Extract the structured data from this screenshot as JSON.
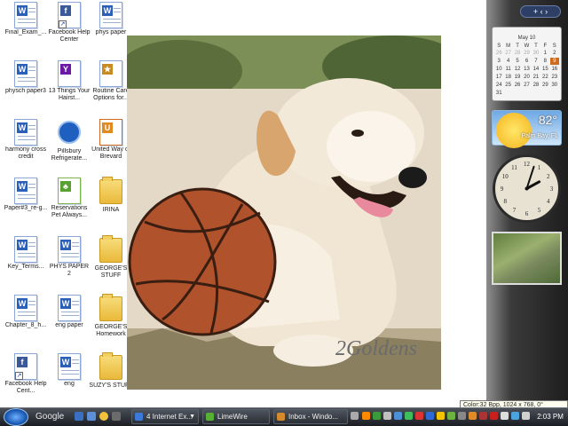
{
  "desktop_icons": [
    {
      "label": "Final_Exam_...",
      "type": "doc"
    },
    {
      "label": "Facebook Help Center",
      "type": "shortcut-page"
    },
    {
      "label": "phys paper",
      "type": "doc"
    },
    {
      "label": "physch paper3",
      "type": "doc"
    },
    {
      "label": "13 Things Your Hairst...",
      "type": "yahoo"
    },
    {
      "label": "Routine Care Options for...",
      "type": "doc-star"
    },
    {
      "label": "harmony cross credit",
      "type": "doc"
    },
    {
      "label": "Pillsbury Refrigerate...",
      "type": "pillsbury"
    },
    {
      "label": "United Way of Brevard",
      "type": "unitedway"
    },
    {
      "label": "Paper#3_re-g...",
      "type": "doc"
    },
    {
      "label": "Reservations Pet Always...",
      "type": "paw"
    },
    {
      "label": "IRINA",
      "type": "folder"
    },
    {
      "label": "Key_Terms...",
      "type": "doc"
    },
    {
      "label": "PHYS PAPER 2",
      "type": "doc"
    },
    {
      "label": "GEORGE'S STUFF",
      "type": "folder"
    },
    {
      "label": "Chapter_8_h...",
      "type": "doc"
    },
    {
      "label": "eng paper",
      "type": "doc"
    },
    {
      "label": "GEORGE'S Homework",
      "type": "folder"
    },
    {
      "label": "Facebook Help Cent...",
      "type": "shortcut-fb"
    },
    {
      "label": "eng",
      "type": "doc"
    },
    {
      "label": "SUZY'S STUFF",
      "type": "folder"
    }
  ],
  "wallpaper": {
    "watermark": "2Goldens"
  },
  "sidebar": {
    "controls": "+  ‹  ›",
    "calendar": {
      "month_label": "May 10",
      "weekdays": [
        "S",
        "M",
        "T",
        "W",
        "T",
        "F",
        "S"
      ],
      "days": [
        "26",
        "27",
        "28",
        "29",
        "30",
        "1",
        "2",
        "3",
        "4",
        "5",
        "6",
        "7",
        "8",
        "9",
        "10",
        "11",
        "12",
        "13",
        "14",
        "15",
        "16",
        "17",
        "18",
        "19",
        "20",
        "21",
        "22",
        "23",
        "24",
        "25",
        "26",
        "27",
        "28",
        "29",
        "30",
        "31",
        "",
        "",
        "",
        "",
        "",
        ""
      ],
      "dim_days_count": 5,
      "today": "9"
    },
    "weather": {
      "temperature": "82°",
      "location": "Palm Bay, FL"
    },
    "clock": {
      "hour": 2,
      "minute": 3
    },
    "slideshow": {}
  },
  "tooltip": "Color:32 Bpp, 1024 x 768, 0°",
  "taskbar": {
    "search_label": "Google",
    "tasks": [
      {
        "label": "4 Internet Ex...",
        "color": "#3b7ad8"
      },
      {
        "label": "LimeWire",
        "color": "#56b132"
      },
      {
        "label": "Inbox - Windo...",
        "color": "#d28a2b"
      }
    ],
    "time": "2:03 PM"
  }
}
